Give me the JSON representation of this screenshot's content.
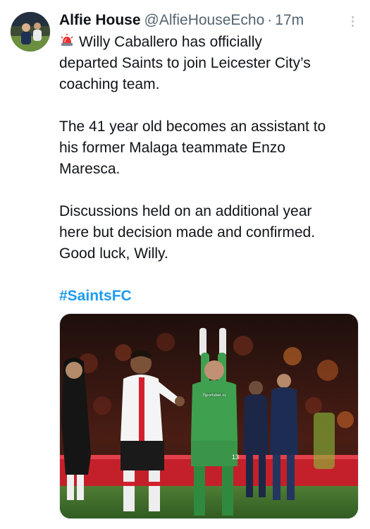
{
  "author": {
    "name": "Alfie House",
    "handle": "@AlfieHouseEcho",
    "separator": "·",
    "time": "17m"
  },
  "icons": {
    "more": "more-options-icon",
    "siren": "police-light-emoji-icon"
  },
  "colors": {
    "text": "#0f1419",
    "secondary": "#536471",
    "link": "#1d9bf0"
  },
  "tweet": {
    "paragraphs": [
      [
        "Willy Caballero has officially",
        "departed Saints to join Leicester City’s",
        "coaching team."
      ],
      [
        "The 41 year old becomes an assistant to",
        "his former Malaga teammate Enzo",
        "Maresca."
      ],
      [
        "Discussions held on an additional year",
        "here but decision made and confirmed.",
        "Good luck, Willy."
      ]
    ],
    "hashtag": "#SaintsFC"
  },
  "media": {
    "sponsor_text": "Sportsbet.io",
    "shirt_number": "13"
  }
}
